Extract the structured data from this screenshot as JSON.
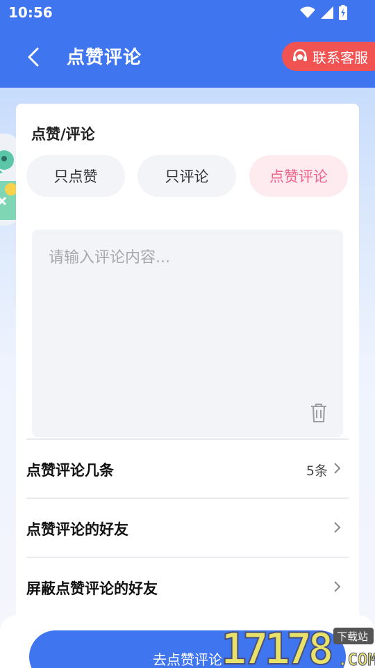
{
  "status_bar": {
    "time": "10:56"
  },
  "header": {
    "title": "点赞评论",
    "service_label": "联系客服"
  },
  "mode": {
    "section_label": "点赞/评论",
    "options": [
      "只点赞",
      "只评论",
      "点赞评论"
    ],
    "selected": "点赞评论"
  },
  "comment": {
    "placeholder": "请输入评论内容..."
  },
  "settings": {
    "count_label": "点赞评论几条",
    "count_value": "5条",
    "friends_label": "点赞评论的好友",
    "blocked_label": "屏蔽点赞评论的好友"
  },
  "cta": {
    "label": "去点赞评论"
  },
  "watermark": {
    "text": "17178",
    "suffix": ".COM",
    "tag": "下载站"
  },
  "colors": {
    "brand_blue": "#3f76f0",
    "service_red": "#f15252",
    "active_pink": "#f0628a",
    "active_bg": "#fdebef"
  }
}
